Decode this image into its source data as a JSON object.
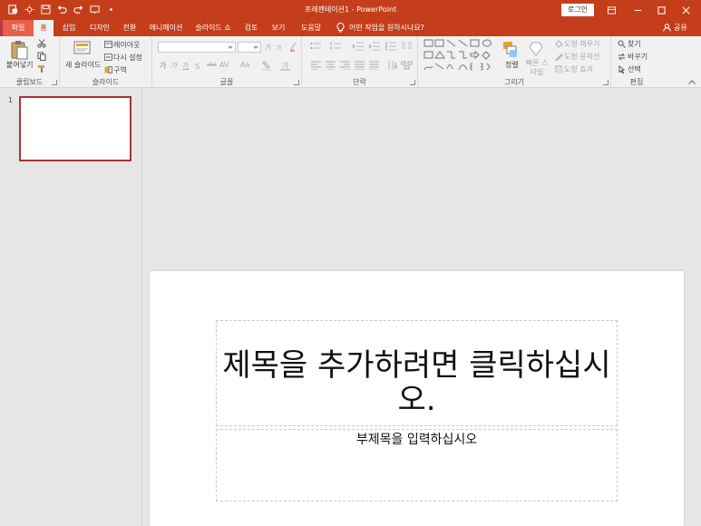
{
  "window": {
    "doc_title": "프레젠테이션1 - PowerPoint",
    "login_label": "로그인"
  },
  "tabs": [
    {
      "label": "파일"
    },
    {
      "label": "홈"
    },
    {
      "label": "삽입"
    },
    {
      "label": "디자인"
    },
    {
      "label": "전환"
    },
    {
      "label": "애니메이션"
    },
    {
      "label": "슬라이드 쇼"
    },
    {
      "label": "검토"
    },
    {
      "label": "보기"
    },
    {
      "label": "도움말"
    }
  ],
  "tell_me": "어떤 작업을 원하시나요?",
  "share": "공유",
  "ribbon": {
    "clipboard": {
      "paste": "붙여넣기",
      "group": "클립보드"
    },
    "slides": {
      "new_slide": "새 슬라이드",
      "layout": "레이아웃",
      "reset": "다시 설정",
      "section": "구역",
      "group": "슬라이드"
    },
    "font": {
      "size_up": "가",
      "size_down": "가",
      "color_a": "가",
      "bold_b": "가",
      "strike": "abc",
      "spacing": "AV",
      "case": "Aa",
      "group": "글꼴"
    },
    "paragraph": {
      "group": "단락"
    },
    "drawing": {
      "arrange": "정렬",
      "quick_styles": "빠른 스타일",
      "fill": "도형 채우기",
      "outline": "도형 윤곽선",
      "effects": "도형 효과",
      "group": "그리기"
    },
    "editing": {
      "find": "찾기",
      "replace": "바꾸기",
      "select": "선택",
      "group": "편집"
    }
  },
  "thumbnails": [
    {
      "number": "1"
    }
  ],
  "slide": {
    "title_placeholder": "제목을 추가하려면 클릭하십시오.",
    "subtitle_placeholder": "부제목을 입력하십시오"
  },
  "colors": {
    "accent": "#c43e1c",
    "ribbon_bg": "#f1f1f1",
    "work_bg": "#e6e6e6"
  }
}
